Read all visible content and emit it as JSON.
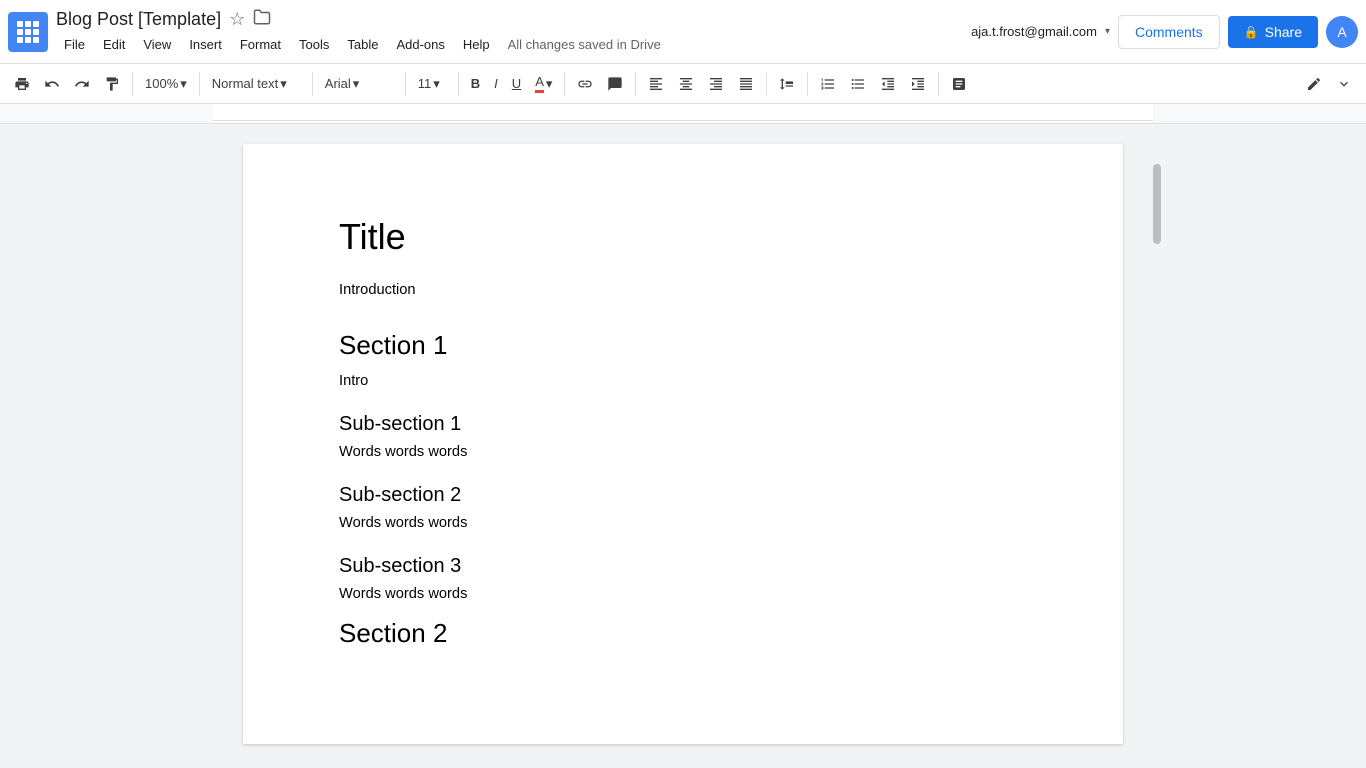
{
  "header": {
    "apps_label": "apps",
    "doc_title": "Blog Post [Template]",
    "star_label": "☆",
    "folder_label": "📁",
    "save_status": "All changes saved in Drive",
    "user_email": "aja.t.frost@gmail.com",
    "user_initial": "A",
    "comments_label": "Comments",
    "share_label": "Share"
  },
  "menu": {
    "items": [
      "File",
      "Edit",
      "View",
      "Insert",
      "Format",
      "Tools",
      "Table",
      "Add-ons",
      "Help"
    ]
  },
  "toolbar": {
    "print_label": "🖨",
    "undo_label": "↺",
    "redo_label": "↻",
    "paint_label": "🖌",
    "zoom_label": "100%",
    "zoom_arrow": "▾",
    "style_label": "Normal text",
    "style_arrow": "▾",
    "font_label": "Arial",
    "font_arrow": "▾",
    "fontsize_label": "11",
    "fontsize_arrow": "▾",
    "bold_label": "B",
    "italic_label": "I",
    "underline_label": "U",
    "color_label": "A",
    "link_label": "🔗",
    "comment_label": "💬",
    "align_left": "≡",
    "align_center": "≡",
    "align_right": "≡",
    "align_justify": "≡",
    "line_spacing": "↕",
    "ol_label": "1.",
    "ul_label": "•",
    "indent_dec": "⇤",
    "indent_inc": "⇥",
    "formula_label": "∑",
    "pen_label": "✏",
    "expand_label": "⌃"
  },
  "document": {
    "title": "Title",
    "intro": "Introduction",
    "section1": "Section 1",
    "section1_intro": "Intro",
    "subsection1": "Sub-section 1",
    "subsection1_body": "Words words words",
    "subsection2": "Sub-section 2",
    "subsection2_body": "Words words words",
    "subsection3": "Sub-section 3",
    "subsection3_body": "Words words words",
    "section2": "Section 2"
  }
}
